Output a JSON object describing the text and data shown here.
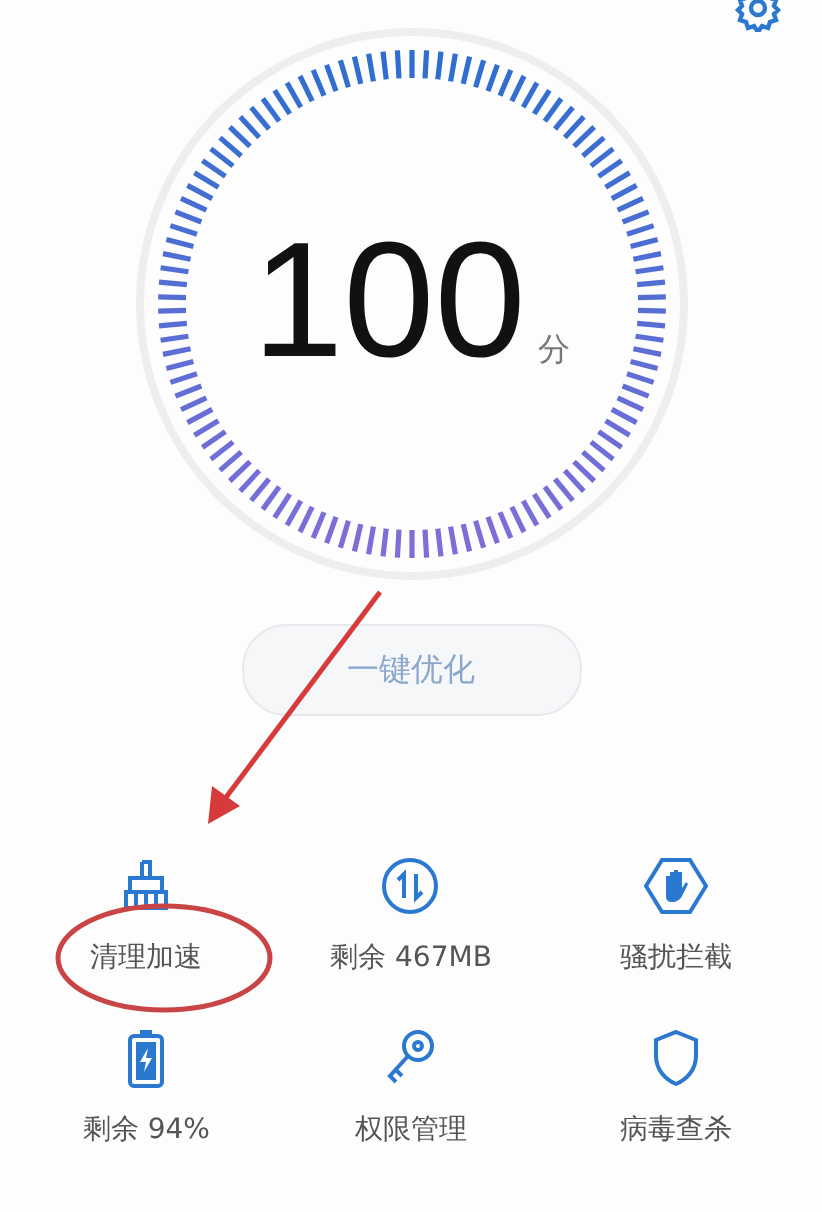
{
  "score": {
    "value": "100",
    "unit": "分"
  },
  "optimize_button": {
    "label": "一键优化",
    "disabled": true
  },
  "tools": [
    {
      "kind": "broom",
      "label": "清理加速"
    },
    {
      "kind": "traffic",
      "label": "剩余 467MB"
    },
    {
      "kind": "block",
      "label": "骚扰拦截"
    },
    {
      "kind": "battery",
      "label": "剩余 94%"
    },
    {
      "kind": "key",
      "label": "权限管理"
    },
    {
      "kind": "shield",
      "label": "病毒查杀"
    }
  ]
}
